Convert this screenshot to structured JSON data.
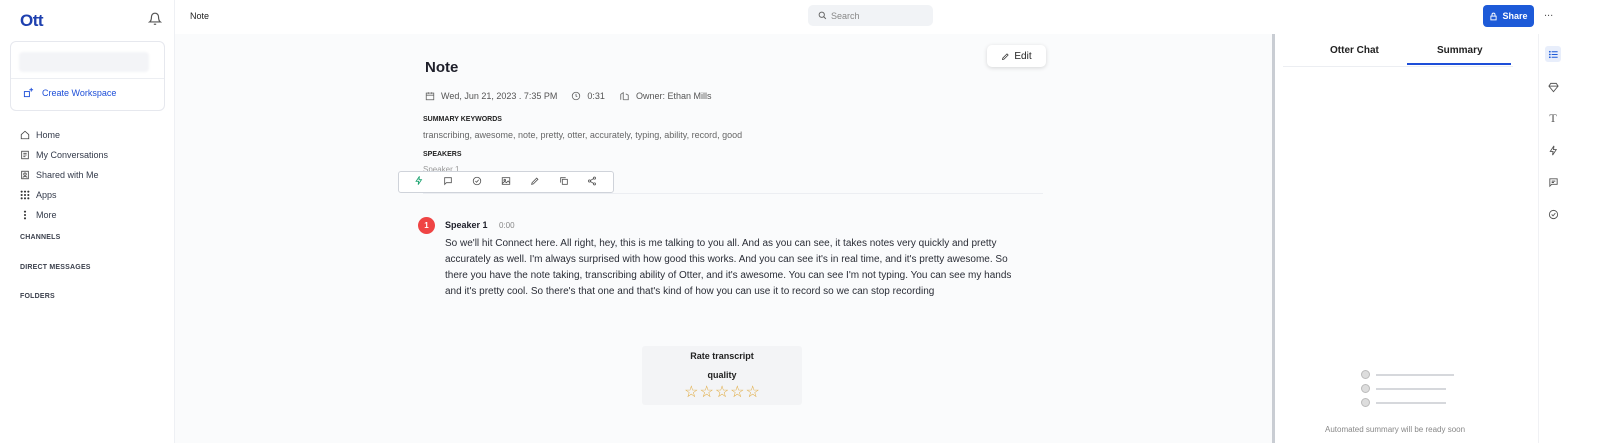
{
  "logo": "Ott",
  "sidebar": {
    "workspace_create": "Create Workspace",
    "nav": [
      {
        "label": "Home",
        "icon": "home-icon"
      },
      {
        "label": "My Conversations",
        "icon": "conversations-icon"
      },
      {
        "label": "Shared with Me",
        "icon": "shared-icon"
      },
      {
        "label": "Apps",
        "icon": "apps-grid-icon"
      },
      {
        "label": "More",
        "icon": "more-vertical-icon"
      }
    ],
    "sections": [
      "CHANNELS",
      "DIRECT MESSAGES",
      "FOLDERS"
    ]
  },
  "topbar": {
    "breadcrumb": "Note",
    "search_placeholder": "Search",
    "share_label": "Share",
    "more_label": "..."
  },
  "note": {
    "edit_label": "Edit",
    "title": "Note",
    "date": "Wed, Jun 21, 2023 . 7:35 PM",
    "duration": "0:31",
    "owner": "Owner: Ethan Mills",
    "keywords_label": "SUMMARY KEYWORDS",
    "keywords": "transcribing, awesome, note, pretty, otter, accurately, typing, ability, record, good",
    "speakers_label": "SPEAKERS",
    "speakers_value": "Speaker 1"
  },
  "transcript": {
    "speaker_number": "1",
    "speaker_name": "Speaker 1",
    "timestamp": "0:00",
    "text": "So we'll hit Connect here. All right, hey, this is me talking to you all. And as you can see, it takes notes very quickly and pretty accurately as well. I'm always surprised with how good this works. And you can see it's in real time, and it's pretty awesome. So there you have the note taking, transcribing ability of Otter, and it's awesome. You can see I'm not typing. You can see my hands and it's pretty cool. So there's that one and that's kind of how you can use it to record so we can stop recording"
  },
  "rating": {
    "line1": "Rate transcript",
    "line2": "quality",
    "stars_total": 5,
    "stars_filled": 0
  },
  "right_panel": {
    "tabs": [
      "Otter Chat",
      "Summary"
    ],
    "active_tab": "Summary",
    "pending_text": "Automated summary will be ready soon"
  },
  "colors": {
    "accent": "#1d5ad8",
    "speaker_badge": "#ef4444",
    "star": "#e0a83a"
  }
}
